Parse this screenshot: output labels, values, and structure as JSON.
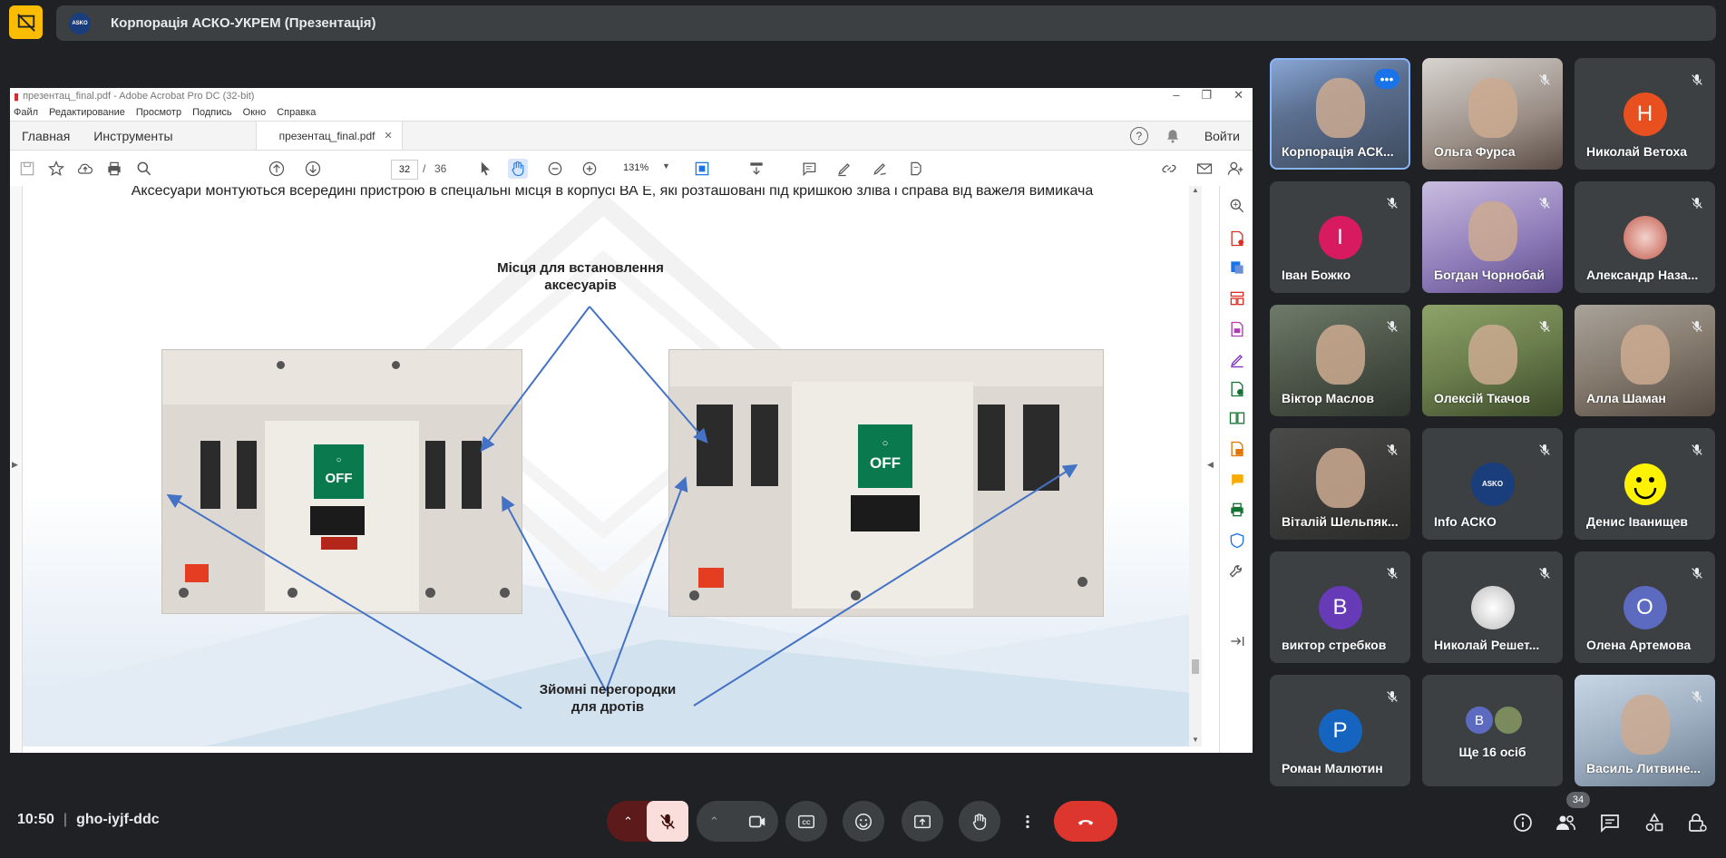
{
  "meeting": {
    "title": "Корпорація АСКО-УКРЕМ (Презентація)",
    "time": "10:50",
    "code": "gho-iyjf-ddc",
    "participant_count": "34"
  },
  "acrobat": {
    "window_title": "презентац_final.pdf - Adobe Acrobat Pro DC (32-bit)",
    "menu": [
      "Файл",
      "Редактирование",
      "Просмотр",
      "Подпись",
      "Окно",
      "Справка"
    ],
    "tabs": {
      "home": "Главная",
      "tools": "Инструменты",
      "document": "презентац_final.pdf"
    },
    "sign_in": "Войти",
    "current_page": "32",
    "page_sep": "/",
    "total_pages": "36",
    "zoom": "131%"
  },
  "slide": {
    "heading": "Аксесуари монтуються всередині пристрою в спеціальні місця в корпусі ВА Е, які розташовані під кришкою зліва і справа від важеля вимикача",
    "label_top": [
      "Місця для встановлення",
      "аксесуарів"
    ],
    "label_bottom": [
      "Зйомні перегородки",
      "для дротів"
    ],
    "switch_text": "OFF"
  },
  "participants": [
    {
      "name": "Корпорація АСК...",
      "type": "video"
    },
    {
      "name": "Ольга Фурса",
      "type": "video"
    },
    {
      "name": "Николай Ветоха",
      "type": "avatar",
      "initial": "Н",
      "color": "#e8511f"
    },
    {
      "name": "Іван Божко",
      "type": "avatar",
      "initial": "І",
      "color": "#d81b60"
    },
    {
      "name": "Богдан Чорнобай",
      "type": "video"
    },
    {
      "name": "Александр Наза...",
      "type": "photo"
    },
    {
      "name": "Віктор Маслов",
      "type": "video"
    },
    {
      "name": "Олексій Ткачов",
      "type": "video"
    },
    {
      "name": "Алла Шаман",
      "type": "video"
    },
    {
      "name": "Віталій Шельпяк...",
      "type": "video"
    },
    {
      "name": "Info АСКО",
      "type": "logo"
    },
    {
      "name": "Денис Іванищев",
      "type": "smiley"
    },
    {
      "name": "виктор стребков",
      "type": "avatar",
      "initial": "В",
      "color": "#673ab7"
    },
    {
      "name": "Николай Решет...",
      "type": "photo"
    },
    {
      "name": "Олена Артемова",
      "type": "avatar",
      "initial": "О",
      "color": "#5c6bc0"
    },
    {
      "name": "Роман Малютин",
      "type": "avatar",
      "initial": "Р",
      "color": "#1565c0"
    },
    {
      "name": "Ще 16 осіб",
      "type": "more",
      "initial": "В"
    },
    {
      "name": "Василь Литвине...",
      "type": "video"
    }
  ]
}
